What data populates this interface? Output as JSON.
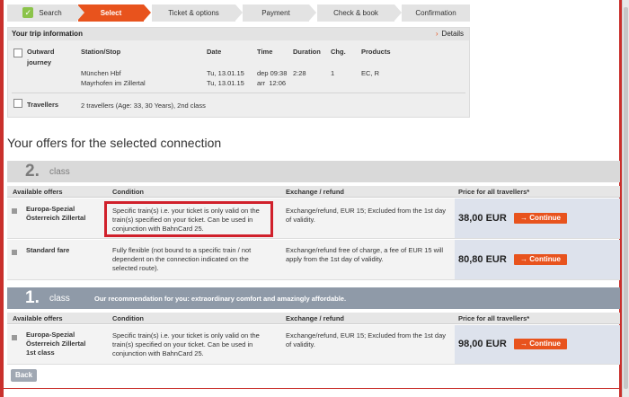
{
  "steps": [
    {
      "label": "Search",
      "state": "done"
    },
    {
      "label": "Select",
      "state": "active"
    },
    {
      "label": "Ticket & options",
      "state": "todo"
    },
    {
      "label": "Payment",
      "state": "todo"
    },
    {
      "label": "Check & book",
      "state": "todo"
    },
    {
      "label": "Confirmation",
      "state": "todo"
    }
  ],
  "trip": {
    "header": "Your trip information",
    "details_link": "Details",
    "outward_label_1": "Outward",
    "outward_label_2": "journey",
    "col_station": "Station/Stop",
    "col_date": "Date",
    "col_time": "Time",
    "col_duration": "Duration",
    "col_changes": "Chg.",
    "col_products": "Products",
    "from_station": "München Hbf",
    "to_station": "Mayrhofen im Zillertal",
    "from_date": "Tu, 13.01.15",
    "to_date": "Tu, 13.01.15",
    "dep_time": "dep 09:38",
    "arr_time": "arr  12:06",
    "duration": "2:28",
    "changes": "1",
    "products": "EC, R",
    "travellers_label": "Travellers",
    "travellers_value": "2 travellers (Age: 33, 30 Years), 2nd class"
  },
  "title": "Your offers for the selected connection",
  "class2": {
    "number": "2.",
    "label": "class",
    "headers": {
      "offers": "Available offers",
      "condition": "Condition",
      "exchange": "Exchange / refund",
      "price": "Price for all travellers*"
    },
    "rows": [
      {
        "name_1": "Europa-Spezial",
        "name_2": "Österreich Zillertal",
        "cond_1": "Specific train(s) i.e. your ticket is only valid on the",
        "cond_2": "train(s) specified on your ticket. Can be used in",
        "cond_3": "conjunction with BahnCard 25.",
        "exch_1": "Exchange/refund, EUR 15; Excluded from the 1st day",
        "exch_2": "of validity.",
        "price": "38,00 EUR",
        "button": "Continue"
      },
      {
        "name_1": "Standard fare",
        "cond_1": "Fully flexible (not bound to a specific train / not",
        "cond_2": "dependent on the connection indicated on the",
        "cond_3": "selected route).",
        "exch_1": "Exchange/refund free of charge, a fee of EUR 15 will",
        "exch_2": "apply from the 1st day of validity.",
        "price": "80,80 EUR",
        "button": "Continue"
      }
    ]
  },
  "class1": {
    "number": "1.",
    "label": "class",
    "recommendation": "Our recommendation for you: extraordinary comfort and amazingly affordable.",
    "headers": {
      "offers": "Available offers",
      "condition": "Condition",
      "exchange": "Exchange / refund",
      "price": "Price for all travellers*"
    },
    "rows": [
      {
        "name_1": "Europa-Spezial",
        "name_2": "Österreich Zillertal",
        "name_3": "1st class",
        "cond_1": "Specific train(s) i.e. your ticket is only valid on the",
        "cond_2": "train(s) specified on your ticket. Can be used in",
        "cond_3": "conjunction with BahnCard 25.",
        "exch_1": "Exchange/refund, EUR 15; Excluded from the 1st day",
        "exch_2": "of validity.",
        "price": "98,00 EUR",
        "button": "Continue"
      }
    ]
  },
  "back_button": "Back",
  "colors": {
    "accent": "#e8531d",
    "highlight": "#d0202b",
    "first_class_bar": "#8f9aa8",
    "price_cell": "#dde2ec"
  }
}
